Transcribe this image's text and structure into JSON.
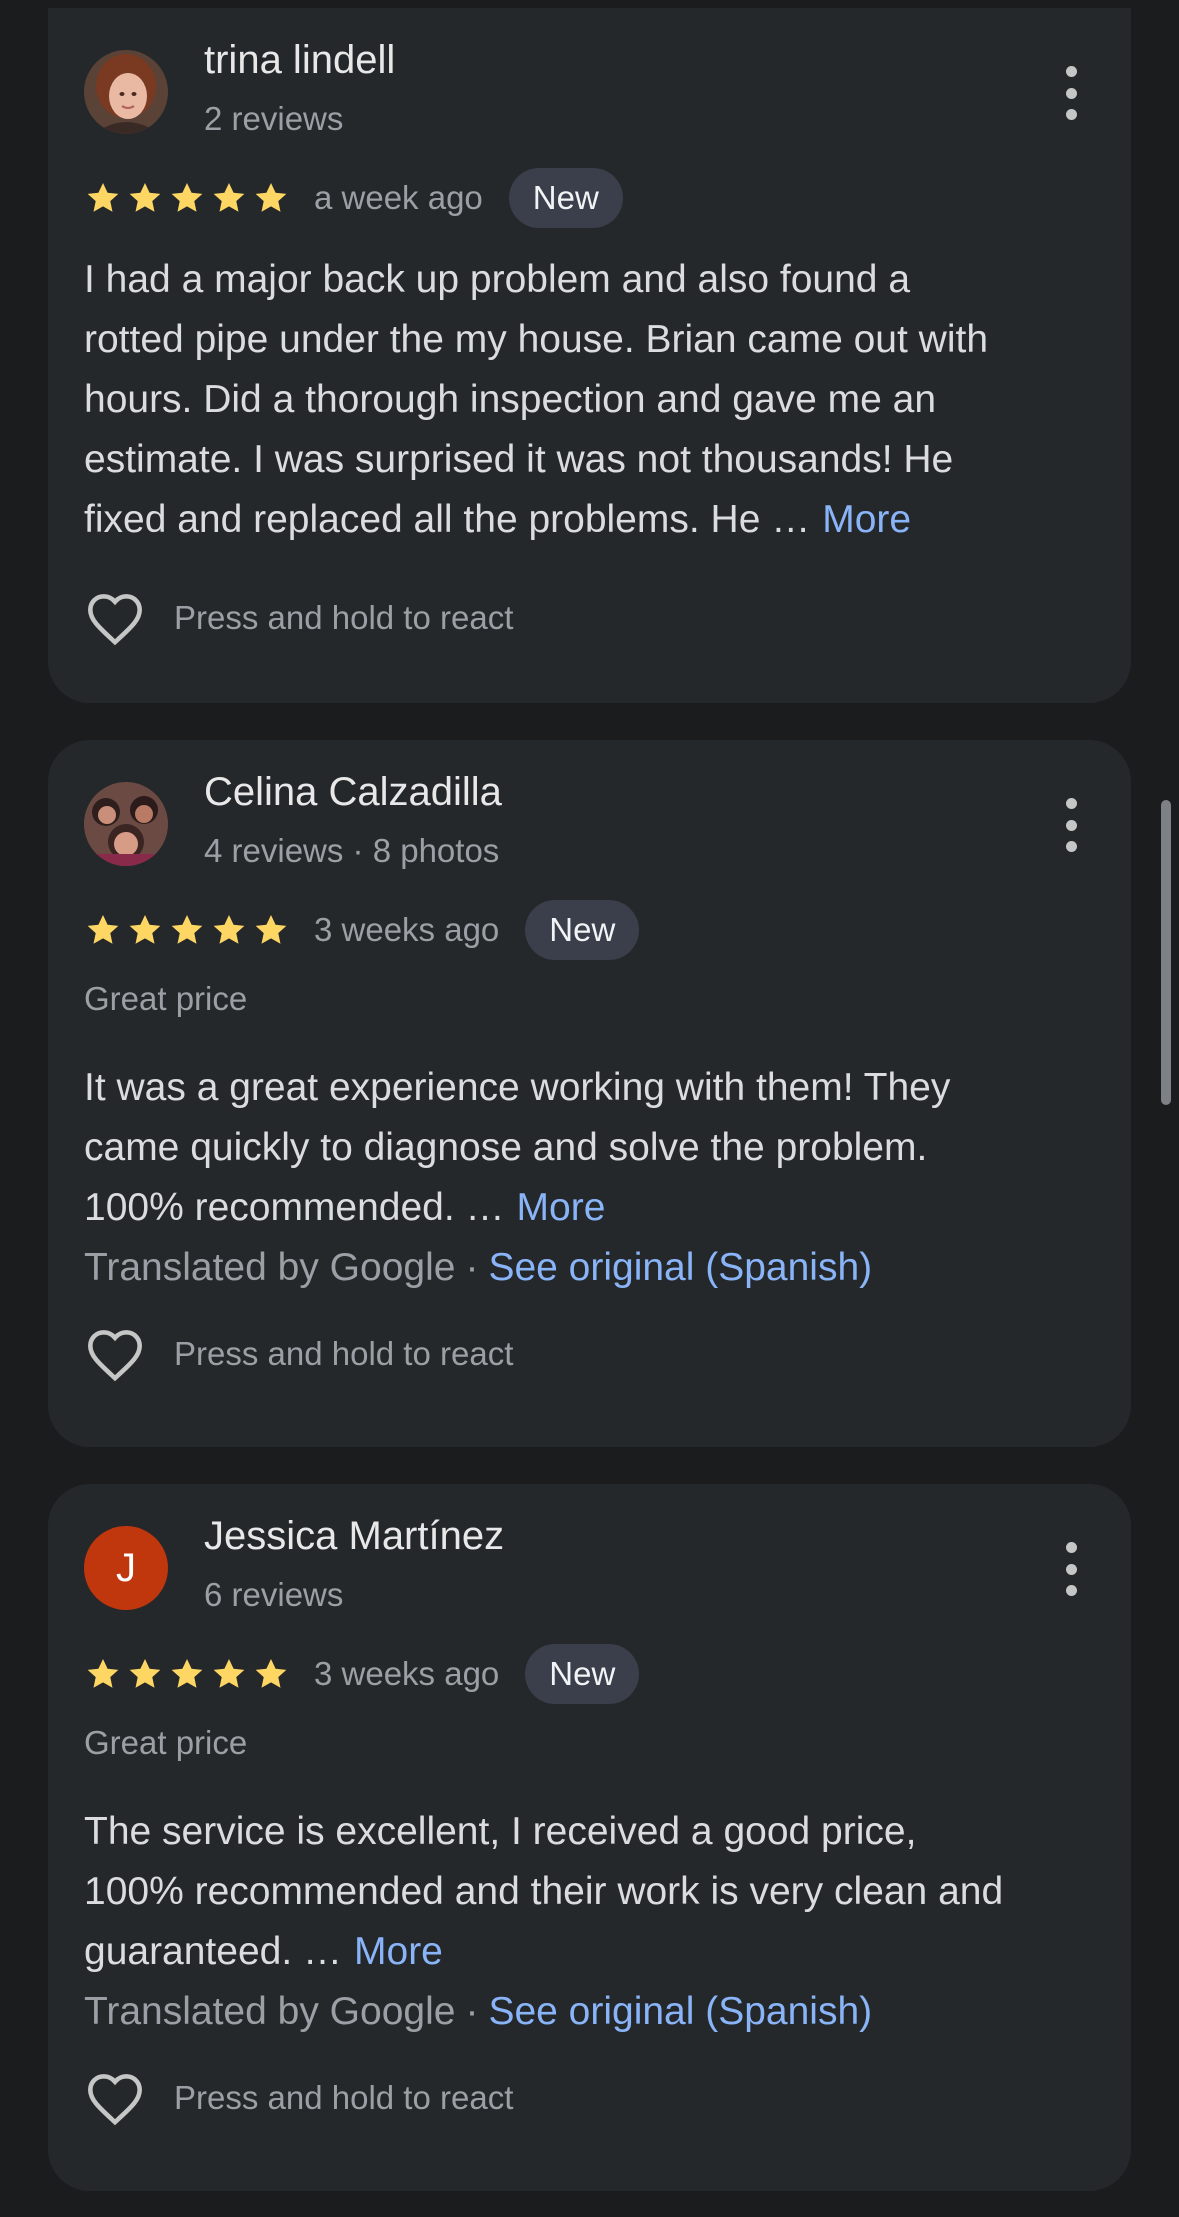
{
  "reviews": [
    {
      "name": "trina lindell",
      "meta": "2 reviews",
      "date": "a week ago",
      "badge": "New",
      "tag": "",
      "text": "I had a major back up problem and also found a\nrotted pipe under the my house. Brian came out with\nhours. Did a thorough inspection and gave me an\nestimate. I was surprised it was not thousands! He\nfixed and replaced all the problems. He …",
      "more": "More",
      "translated_by": "",
      "see_original": "",
      "react": "Press and hold to react",
      "rating": 5
    },
    {
      "name": "Celina Calzadilla",
      "meta": "4 reviews · 8 photos",
      "date": "3 weeks ago",
      "badge": "New",
      "tag": "Great price",
      "text": "It was a great experience working with them! They\ncame quickly to diagnose and solve the problem.\n100% recommended. …",
      "more": "More",
      "translated_by": "Translated by Google",
      "dot": "·",
      "see_original": "See original (Spanish)",
      "react": "Press and hold to react",
      "rating": 5
    },
    {
      "name": "Jessica Martínez",
      "avatar_letter": "J",
      "meta": "6 reviews",
      "date": "3 weeks ago",
      "badge": "New",
      "tag": "Great price",
      "text": "The service is excellent, I received a good price,\n100% recommended and their work is very clean and\nguaranteed. …",
      "more": "More",
      "translated_by": "Translated by Google",
      "dot": "·",
      "see_original": "See original (Spanish)",
      "react": "Press and hold to react",
      "rating": 5
    }
  ],
  "colors": {
    "background": "#1b1c1e",
    "card": "#25282a",
    "star": "#fdd663",
    "link": "#8ab4f8",
    "badge": "#3a3f4b",
    "avatar_j": "#c0360d"
  },
  "icons": {
    "star": "star-icon",
    "menu": "more-vert-icon",
    "heart": "heart-outline-icon"
  }
}
